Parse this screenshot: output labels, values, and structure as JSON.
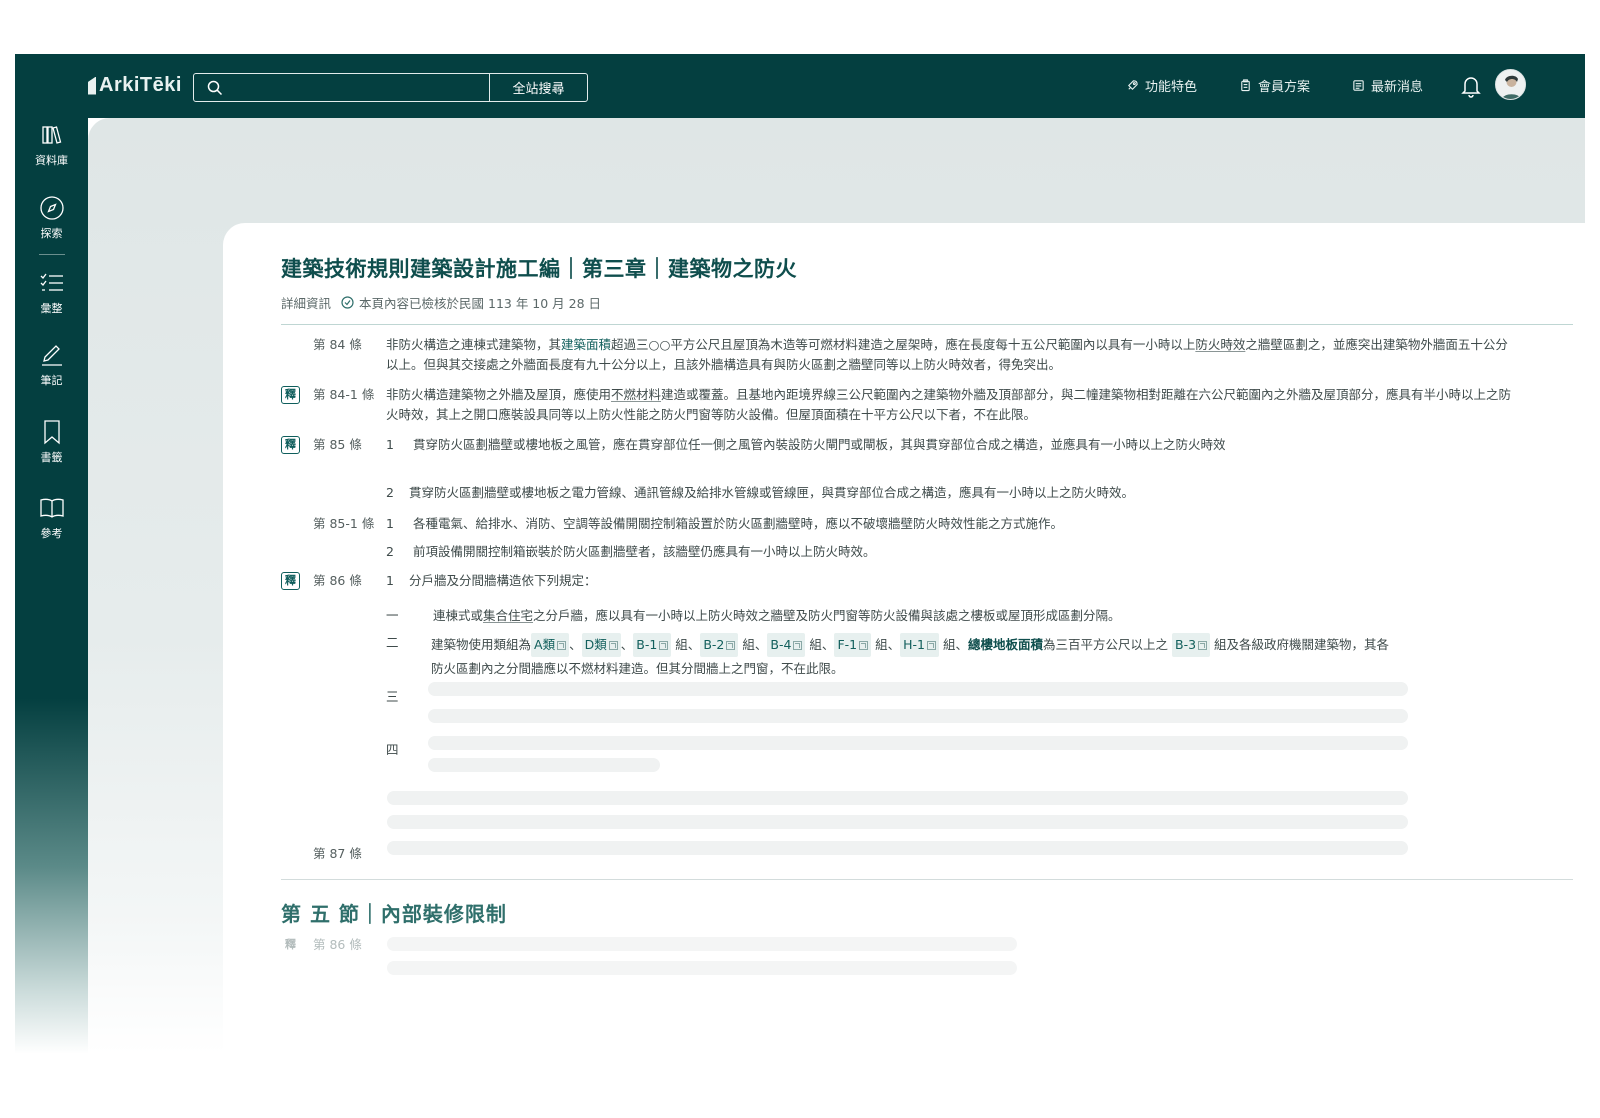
{
  "app": {
    "logo_text": "ArkiTēki"
  },
  "search": {
    "placeholder": "",
    "button_label": "全站搜尋"
  },
  "nav": {
    "features": "功能特色",
    "membership": "會員方案",
    "news": "最新消息"
  },
  "sidebar": {
    "items": [
      {
        "label": "資料庫",
        "icon": "books-icon"
      },
      {
        "label": "探索",
        "icon": "compass-icon"
      },
      {
        "label": "彙整",
        "icon": "checklist-icon"
      },
      {
        "label": "筆記",
        "icon": "pencil-icon"
      },
      {
        "label": "書籤",
        "icon": "bookmark-icon"
      },
      {
        "label": "參考",
        "icon": "open-book-icon"
      }
    ]
  },
  "page": {
    "title": "建築技術規則建築設計施工編｜第三章｜建築物之防火",
    "details_label": "詳細資訊",
    "verified_text": "本頁內容已檢核於民國 113 年 10 月 28 日"
  },
  "badge_label": "釋",
  "articles": {
    "a84": {
      "num": "第 84 條",
      "t1": "非防火構造之連棟式建築物，其",
      "link1": "建築面積",
      "t2": "超過三○○平方公尺且屋頂為木造等可燃材料建造之屋架時，應在長度每十五公尺範圍內以具有一小時以上",
      "link2": "防火時效",
      "t3": "之牆壁區劃之，並應突出建築物外牆面五十公分以上。但與其交接處之外牆面長度有九十公分以上，且該外牆構造具有與防火區劃之牆壁同等以上防火時效者，得免突出。"
    },
    "a84_1": {
      "num": "第 84-1 條",
      "t1": "非防火構造建築物之外牆及屋頂，應使用",
      "link1": "不燃材料",
      "t2": "建造或覆蓋。且基地內距境界線三公尺範圍內之建築物外牆及頂部部分，與二幢建築物相對距離在六公尺範圍內之外牆及屋頂部分，應具有半小時以上之防火時效，其上之開口應裝設具同等以上防火性能之防火門窗等防火設備。但屋頂面積在十平方公尺以下者，不在此限。"
    },
    "a85": {
      "num": "第 85 條",
      "p1_num": "1",
      "p1": "貫穿防火區劃牆壁或樓地板之風管，應在貫穿部位任一側之風管內裝設防火閘門或閘板，其與貫穿部位合成之構造，並應具有一小時以上之防火時效",
      "p2_num": "2",
      "p2": "貫穿防火區劃牆壁或樓地板之電力管線、通訊管線及給排水管線或管線匣，與貫穿部位合成之構造，應具有一小時以上之防火時效。"
    },
    "a85_1": {
      "num": "第 85-1 條",
      "p1_num": "1",
      "p1": "各種電氣、給排水、消防、空調等設備開關控制箱設置於防火區劃牆壁時，應以不破壞牆壁防火時效性能之方式施作。",
      "p2_num": "2",
      "p2": "前項設備開關控制箱嵌裝於防火區劃牆壁者，該牆壁仍應具有一小時以上防火時效。"
    },
    "a86": {
      "num": "第 86 條",
      "p1_num": "1",
      "p1": "分戶牆及分間牆構造依下列規定：",
      "i1_num": "一",
      "i1_a": "連棟式或",
      "i1_link": "集合住宅",
      "i1_b": "之分戶牆，應以具有一小時以上防火時效之牆壁及防火門窗等防火設備與該處之樓板或屋頂形成區劃分隔。",
      "i2_num": "二",
      "i2_a": "建築物使用類組為",
      "tags": [
        "A類",
        "D類",
        "B-1",
        "B-2",
        "B-4",
        "F-1",
        "H-1",
        "B-3"
      ],
      "sep_dun": "、",
      "zu": "組",
      "i2_term": "總樓地板面積",
      "i2_b": "為三百平方公尺以上之",
      "i2_c": "組及各級政府機關建築物，其各防火區劃內之分間牆應以不燃材料建造。但其分間牆上之門窗，不在此限。",
      "i3_num": "三",
      "i4_num": "四"
    },
    "a87": {
      "num": "第 87 條"
    }
  },
  "section": {
    "title": "第 五 節｜內部裝修限制",
    "faded_num": "第 86 條"
  }
}
